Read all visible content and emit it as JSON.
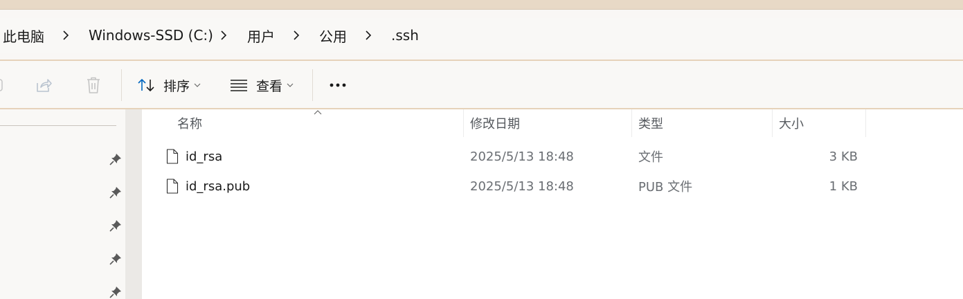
{
  "breadcrumb": {
    "items": [
      "此电脑",
      "Windows-SSD (C:)",
      "用户",
      "公用",
      ".ssh"
    ]
  },
  "toolbar": {
    "sort_label": "排序",
    "view_label": "查看",
    "more_label": "•••"
  },
  "file_list": {
    "columns": [
      "名称",
      "修改日期",
      "类型",
      "大小"
    ],
    "rows": [
      {
        "name": "id_rsa",
        "modified": "2025/5/13 18:48",
        "type": "文件",
        "size": "3 KB"
      },
      {
        "name": "id_rsa.pub",
        "modified": "2025/5/13 18:48",
        "type": "PUB 文件",
        "size": "1 KB"
      }
    ]
  },
  "colors": {
    "accent": "#0067c0",
    "title_strip": "#e8d9c6",
    "divider": "#e6d2ba"
  }
}
